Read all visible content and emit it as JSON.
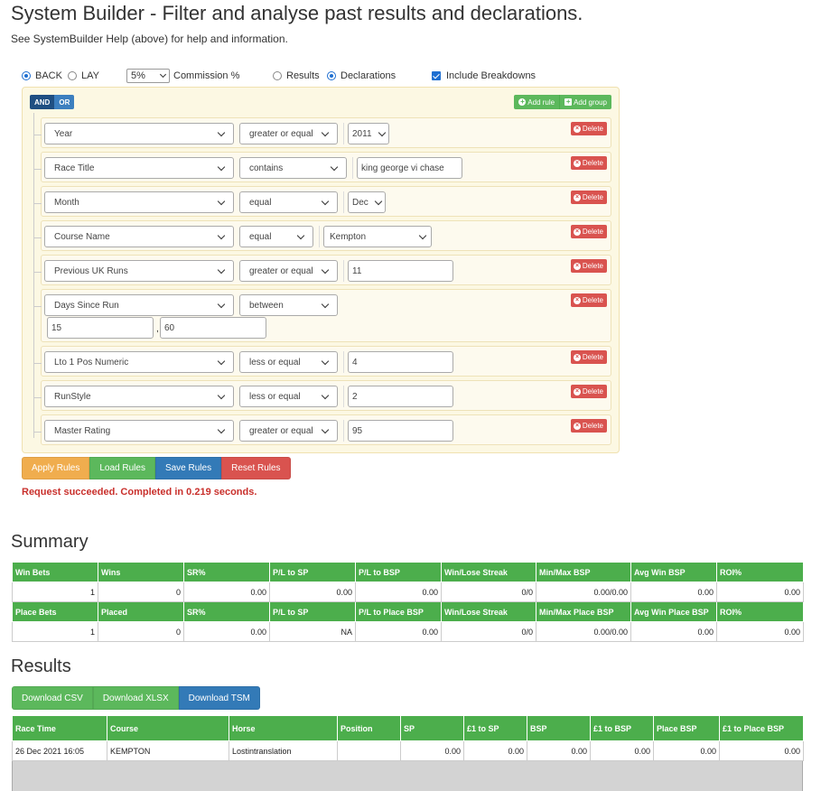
{
  "page": {
    "title": "System Builder - Filter and analyse past results and declarations.",
    "subtitle": "See SystemBuilder Help (above) for help and information."
  },
  "options": {
    "back_label": "BACK",
    "lay_label": "LAY",
    "commission_value": "5%",
    "commission_label": "Commission %",
    "results_label": "Results",
    "declarations_label": "Declarations",
    "include_breakdowns_label": "Include Breakdowns",
    "back_selected": true,
    "declarations_selected": true,
    "include_breakdowns_checked": true
  },
  "builder": {
    "and_label": "AND",
    "or_label": "OR",
    "add_rule_label": "Add rule",
    "add_group_label": "Add group",
    "delete_label": "Delete",
    "rules": [
      {
        "field": "Year",
        "operator": "greater or equal",
        "value": "2011",
        "value_type": "select"
      },
      {
        "field": "Race Title",
        "operator": "contains",
        "value": "king george vi chase",
        "value_type": "input"
      },
      {
        "field": "Month",
        "operator": "equal",
        "value": "Dec",
        "value_type": "select"
      },
      {
        "field": "Course Name",
        "operator": "equal",
        "value": "Kempton",
        "value_type": "select"
      },
      {
        "field": "Previous UK Runs",
        "operator": "greater or equal",
        "value": "11",
        "value_type": "input"
      },
      {
        "field": "Days Since Run",
        "operator": "between",
        "value": "15",
        "value2": "60",
        "value_type": "between"
      },
      {
        "field": "Lto 1 Pos Numeric",
        "operator": "less or equal",
        "value": "4",
        "value_type": "input"
      },
      {
        "field": "RunStyle",
        "operator": "less or equal",
        "value": "2",
        "value_type": "input"
      },
      {
        "field": "Master Rating",
        "operator": "greater or equal",
        "value": "95",
        "value_type": "input"
      }
    ]
  },
  "actions": {
    "apply": "Apply Rules",
    "load": "Load Rules",
    "save": "Save Rules",
    "reset": "Reset Rules",
    "status": "Request succeeded. Completed in 0.219 seconds."
  },
  "summary": {
    "heading": "Summary",
    "win_headers": [
      "Win Bets",
      "Wins",
      "SR%",
      "P/L to SP",
      "P/L to BSP",
      "Win/Lose Streak",
      "Min/Max BSP",
      "Avg Win BSP",
      "ROI%"
    ],
    "win_values": [
      "1",
      "0",
      "0.00",
      "0.00",
      "0.00",
      "0/0",
      "0.00/0.00",
      "0.00",
      "0.00"
    ],
    "place_headers": [
      "Place Bets",
      "Placed",
      "SR%",
      "P/L to SP",
      "P/L to Place BSP",
      "Win/Lose Streak",
      "Min/Max Place BSP",
      "Avg Win Place BSP",
      "ROI%"
    ],
    "place_values": [
      "1",
      "0",
      "0.00",
      "NA",
      "0.00",
      "0/0",
      "0.00/0.00",
      "0.00",
      "0.00"
    ]
  },
  "results": {
    "heading": "Results",
    "download_csv": "Download CSV",
    "download_xlsx": "Download XLSX",
    "download_tsm": "Download TSM",
    "headers": [
      "Race Time",
      "Course",
      "Horse",
      "Position",
      "SP",
      "£1 to SP",
      "BSP",
      "£1 to BSP",
      "Place BSP",
      "£1 to Place BSP"
    ],
    "rows": [
      [
        "26 Dec 2021 16:05",
        "KEMPTON",
        "Lostintranslation",
        "",
        "0.00",
        "0.00",
        "0.00",
        "0.00",
        "0.00",
        "0.00"
      ]
    ]
  },
  "colors": {
    "green": "#5cb85c",
    "table_header": "#4cae4c",
    "blue": "#337ab7",
    "orange": "#f0ad4e",
    "red": "#d9534f",
    "builder_bg": "#fcf8e3",
    "status_text": "#c9302c"
  }
}
